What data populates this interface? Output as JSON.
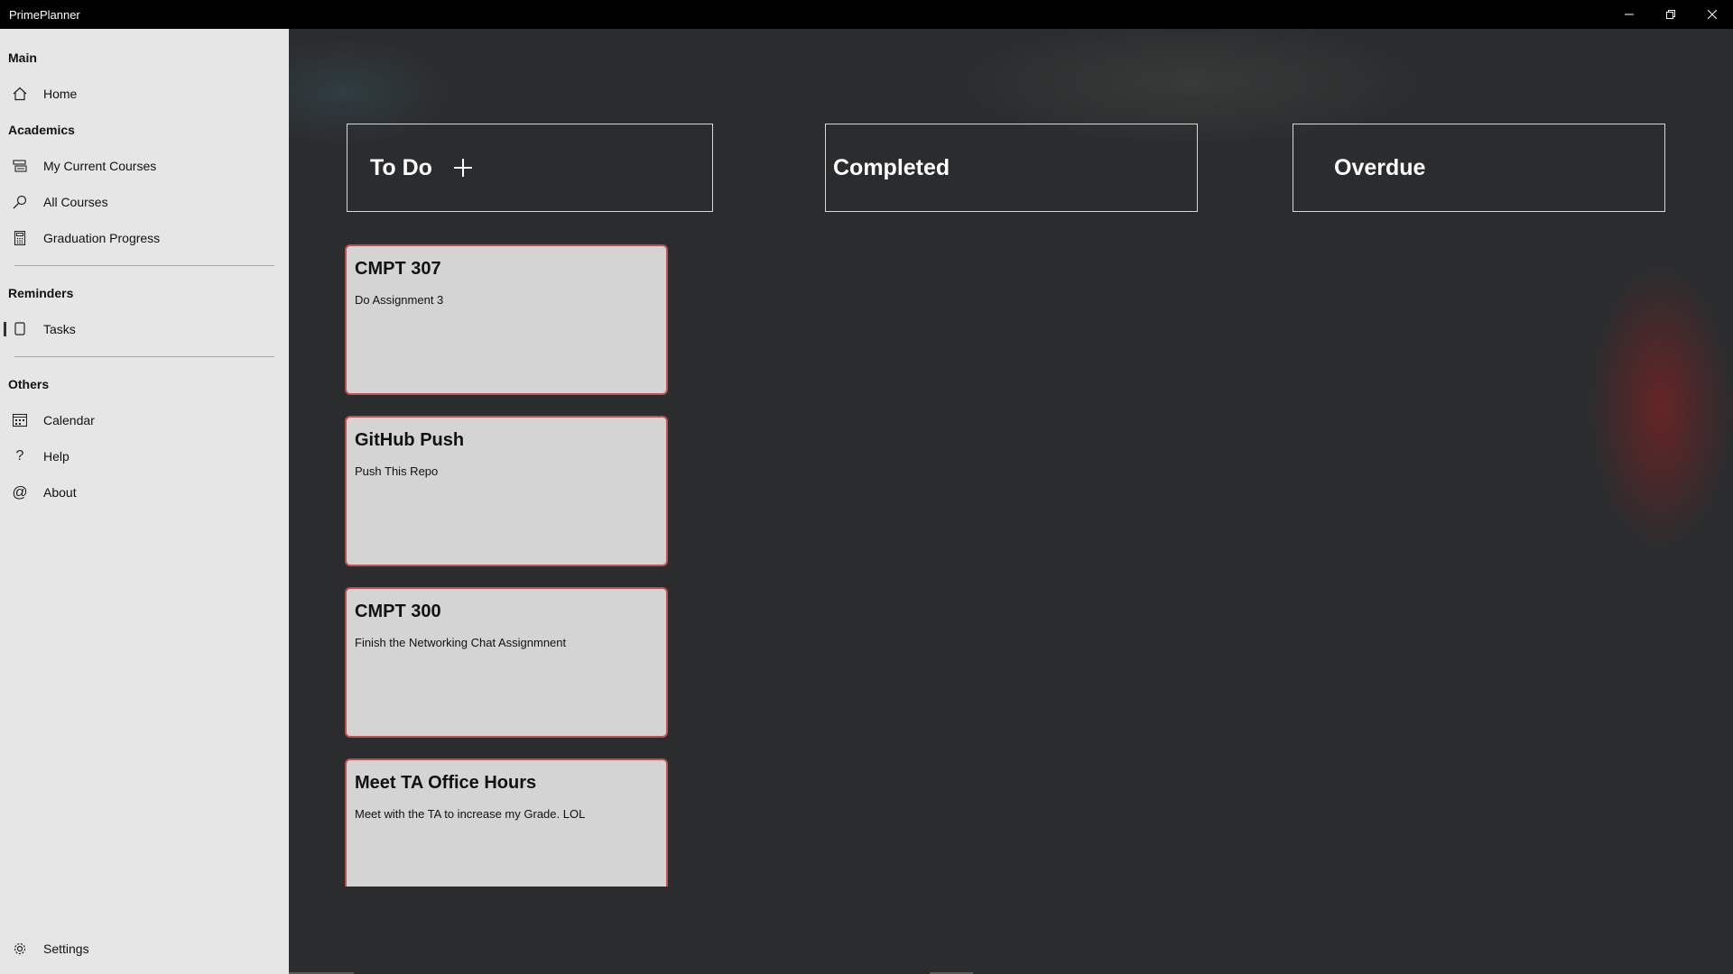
{
  "window": {
    "title": "PrimePlanner",
    "controls": {
      "minimize": "minimize-icon",
      "restore": "restore-icon",
      "close": "close-icon"
    }
  },
  "sidebar": {
    "sections": {
      "main": "Main",
      "academics": "Academics",
      "reminders": "Reminders",
      "others": "Others"
    },
    "items": [
      {
        "label": "Home",
        "icon": "home-icon"
      },
      {
        "label": "My Current Courses",
        "icon": "courses-icon"
      },
      {
        "label": "All Courses",
        "icon": "search-icon"
      },
      {
        "label": "Graduation Progress",
        "icon": "calculator-icon"
      },
      {
        "label": "Tasks",
        "icon": "tasks-icon",
        "selected": true
      },
      {
        "label": "Calendar",
        "icon": "calendar-icon"
      },
      {
        "label": "Help",
        "icon": "help-icon"
      },
      {
        "label": "About",
        "icon": "at-icon"
      }
    ],
    "settings": {
      "label": "Settings",
      "icon": "gear-icon"
    }
  },
  "board": {
    "columns": [
      {
        "title": "To Do",
        "has_add": true
      },
      {
        "title": "Completed"
      },
      {
        "title": "Overdue"
      }
    ],
    "todo_tasks": [
      {
        "title": "CMPT 307",
        "description": "Do Assignment 3"
      },
      {
        "title": "GitHub Push",
        "description": "Push This Repo"
      },
      {
        "title": "CMPT 300",
        "description": "Finish the Networking Chat Assignmnent"
      },
      {
        "title": "Meet TA Office Hours",
        "description": "Meet with the TA to increase my Grade. LOL"
      }
    ]
  },
  "colors": {
    "sidebar_bg": "#e6e6e6",
    "main_bg": "#2b2c2e",
    "card_bg": "#d4d4d4",
    "card_border": "#c0504d",
    "titlebar_bg": "#000000"
  }
}
